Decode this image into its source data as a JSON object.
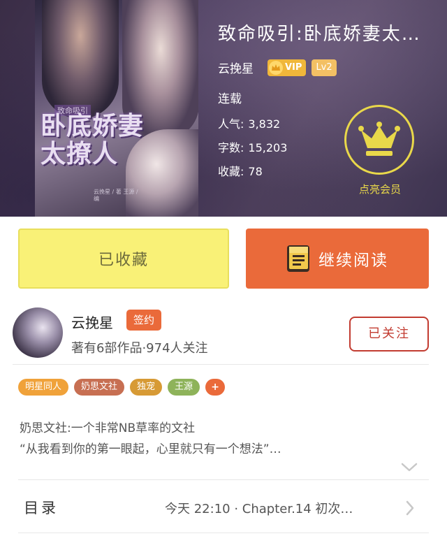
{
  "book": {
    "title": "致命吸引:卧底娇妻太…",
    "author": "云挽星",
    "vip_label": "VIP",
    "level_label": "Lv2",
    "status": "连载",
    "stats": [
      {
        "key": "人气:",
        "value": "3,832"
      },
      {
        "key": "字数:",
        "value": "15,203"
      },
      {
        "key": "收藏:",
        "value": "78"
      }
    ],
    "member_label": "点亮会员",
    "cover": {
      "title": "卧底娇妻太撩人",
      "tag": "致命吸引",
      "small_text": "云挽星 / 著  王源 / 编"
    }
  },
  "actions": {
    "collect_label": "已收藏",
    "read_label": "继续阅读"
  },
  "author_card": {
    "name": "云挽星",
    "sign_badge": "签约",
    "meta": "著有6部作品·974人关注",
    "follow_label": "已关注"
  },
  "tags": [
    {
      "label": "明星同人",
      "color": "#f0a23a"
    },
    {
      "label": "奶思文社",
      "color": "#c76f52"
    },
    {
      "label": "独宠",
      "color": "#d79a35"
    },
    {
      "label": "王源",
      "color": "#8eb35a"
    }
  ],
  "tag_more": "+",
  "tag_more_color": "#ea6a3a",
  "description": {
    "line1": "奶思文社:一个非常NB草率的文社",
    "line2": "“从我看到你的第一眼起，心里就只有一个想法”…"
  },
  "toc": {
    "label": "目录",
    "latest": "今天 22:10 · Chapter.14 初次…"
  },
  "colors": {
    "accent": "#ea6a3a",
    "collect_bg": "#f9f177",
    "gold": "#e9d84a",
    "follow": "#c23b30"
  }
}
